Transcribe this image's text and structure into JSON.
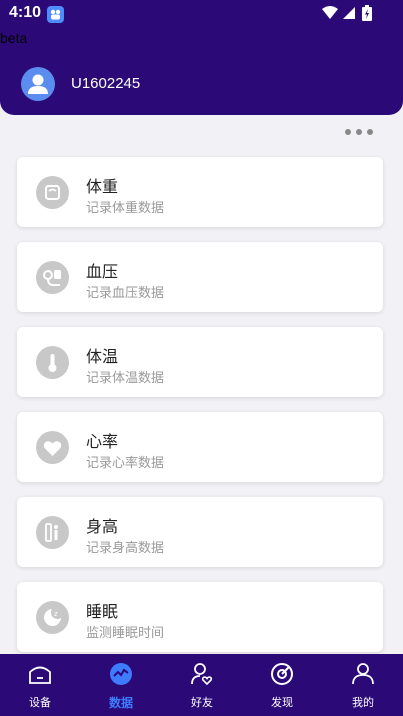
{
  "status_bar": {
    "time": "4:10"
  },
  "beta_label": "beta",
  "user": {
    "id": "U1602245"
  },
  "cards": [
    {
      "title": "体重",
      "subtitle": "记录体重数据",
      "icon": "scale-icon"
    },
    {
      "title": "血压",
      "subtitle": "记录血压数据",
      "icon": "blood-pressure-icon"
    },
    {
      "title": "体温",
      "subtitle": "记录体温数据",
      "icon": "thermometer-icon"
    },
    {
      "title": "心率",
      "subtitle": "记录心率数据",
      "icon": "heart-icon"
    },
    {
      "title": "身高",
      "subtitle": "记录身高数据",
      "icon": "height-icon"
    },
    {
      "title": "睡眠",
      "subtitle": "监测睡眠时间",
      "icon": "sleep-icon"
    }
  ],
  "tabs": [
    {
      "label": "设备",
      "icon": "device-icon"
    },
    {
      "label": "数据",
      "icon": "data-icon",
      "active": true
    },
    {
      "label": "好友",
      "icon": "friends-icon"
    },
    {
      "label": "发现",
      "icon": "discover-icon"
    },
    {
      "label": "我的",
      "icon": "profile-icon"
    }
  ],
  "colors": {
    "header_bg": "#2b0a78",
    "accent": "#3e7bff",
    "card_icon_bg": "#c8c8c8"
  }
}
